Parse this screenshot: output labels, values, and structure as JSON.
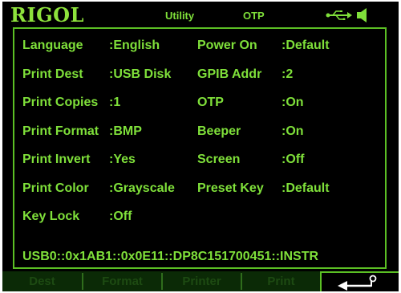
{
  "brand": "RIGOL",
  "header": {
    "mode": "Utility",
    "submode": "OTP",
    "icons": [
      "usb-icon",
      "speaker-icon"
    ]
  },
  "settings_left": [
    {
      "label": "Language",
      "value": ":English"
    },
    {
      "label": "Print Dest",
      "value": ":USB Disk"
    },
    {
      "label": "Print Copies",
      "value": ":1"
    },
    {
      "label": "Print Format",
      "value": ":BMP"
    },
    {
      "label": "Print Invert",
      "value": ":Yes"
    },
    {
      "label": "Print Color",
      "value": ":Grayscale"
    },
    {
      "label": "Key Lock",
      "value": ":Off"
    }
  ],
  "settings_right": [
    {
      "label": "Power On",
      "value": ":Default"
    },
    {
      "label": "GPIB Addr",
      "value": ":2"
    },
    {
      "label": "OTP",
      "value": ":On"
    },
    {
      "label": "Beeper",
      "value": ":On"
    },
    {
      "label": "Screen",
      "value": ":Off"
    },
    {
      "label": "Preset Key",
      "value": ":Default"
    }
  ],
  "resource": "USB0::0x1AB1::0x0E11::DP8C151700451::INSTR",
  "softkeys": [
    {
      "label": "Dest"
    },
    {
      "label": "Format"
    },
    {
      "label": "Printer"
    },
    {
      "label": "Print"
    }
  ],
  "return_icon": "return-arrow-icon",
  "colors": {
    "text": "#7fe03a",
    "border": "#5bbf24",
    "background": "#000000",
    "softkey_dim": "#1d4a12"
  }
}
